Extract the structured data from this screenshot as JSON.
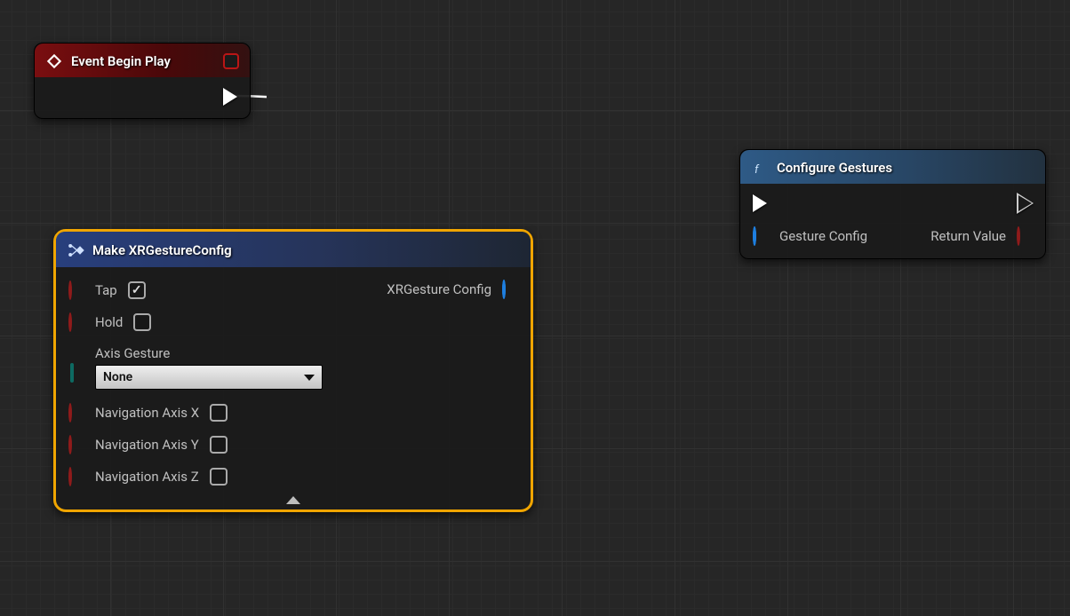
{
  "colors": {
    "exec": "#ffffff",
    "bool": "#8f1b1b",
    "struct": "#0d6a87",
    "structOut": "#1e7fe0"
  },
  "nodes": {
    "event": {
      "title": "Event Begin Play",
      "exec_out": "exec"
    },
    "func": {
      "title": "Configure Gestures",
      "pins": {
        "gesture_config": "Gesture Config",
        "return_value": "Return Value"
      }
    },
    "make": {
      "title": "Make XRGestureConfig",
      "pins": {
        "tap": "Tap",
        "hold": "Hold",
        "axis_label": "Axis Gesture",
        "nav_x": "Navigation Axis X",
        "nav_y": "Navigation Axis Y",
        "nav_z": "Navigation Axis Z",
        "output": "XRGesture Config"
      },
      "axis_value": "None",
      "checks": {
        "tap": true,
        "hold": false,
        "nav_x": false,
        "nav_y": false,
        "nav_z": false
      }
    }
  }
}
